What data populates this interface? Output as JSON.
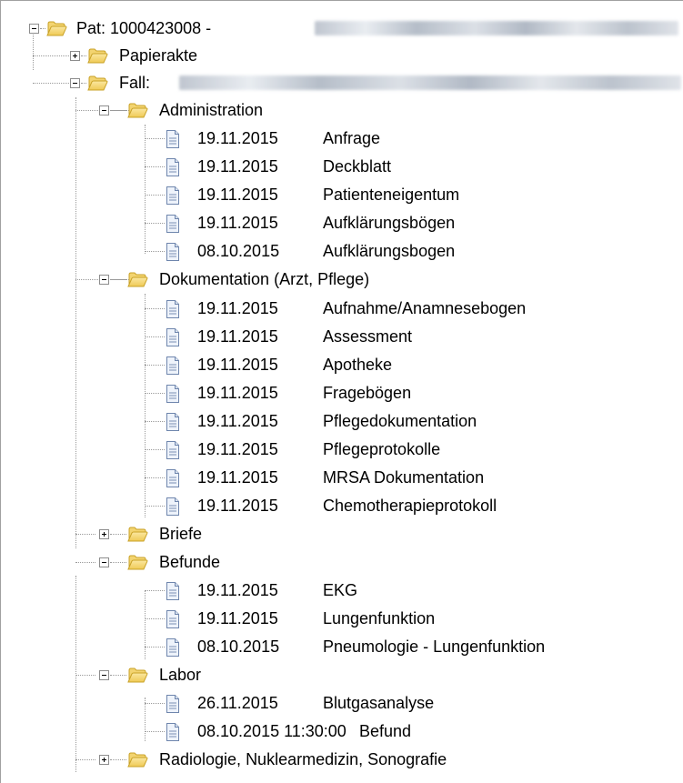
{
  "root": {
    "label": "Pat: 1000423008 -",
    "expanded": true
  },
  "papierakte": {
    "label": "Papierakte",
    "expanded": false
  },
  "fall": {
    "label": "Fall:",
    "expanded": true
  },
  "administration": {
    "label": "Administration",
    "expanded": true,
    "items": [
      {
        "date": "19.11.2015",
        "title": "Anfrage"
      },
      {
        "date": "19.11.2015",
        "title": "Deckblatt"
      },
      {
        "date": "19.11.2015",
        "title": "Patienteneigentum"
      },
      {
        "date": "19.11.2015",
        "title": "Aufklärungsbögen"
      },
      {
        "date": "08.10.2015",
        "title": "Aufklärungsbogen"
      }
    ]
  },
  "dokumentation": {
    "label": "Dokumentation (Arzt, Pflege)",
    "expanded": true,
    "items": [
      {
        "date": "19.11.2015",
        "title": "Aufnahme/Anamnesebogen"
      },
      {
        "date": "19.11.2015",
        "title": "Assessment"
      },
      {
        "date": "19.11.2015",
        "title": "Apotheke"
      },
      {
        "date": "19.11.2015",
        "title": "Fragebögen"
      },
      {
        "date": "19.11.2015",
        "title": "Pflegedokumentation"
      },
      {
        "date": "19.11.2015",
        "title": "Pflegeprotokolle"
      },
      {
        "date": "19.11.2015",
        "title": "MRSA Dokumentation"
      },
      {
        "date": "19.11.2015",
        "title": "Chemotherapieprotokoll"
      }
    ]
  },
  "briefe": {
    "label": "Briefe",
    "expanded": false
  },
  "befunde": {
    "label": "Befunde",
    "expanded": true,
    "items": [
      {
        "date": "19.11.2015",
        "title": "EKG"
      },
      {
        "date": "19.11.2015",
        "title": "Lungenfunktion"
      },
      {
        "date": "08.10.2015",
        "title": "Pneumologie - Lungenfunktion"
      }
    ]
  },
  "labor": {
    "label": "Labor",
    "expanded": true,
    "items": [
      {
        "date": "26.11.2015",
        "title": "Blutgasanalyse"
      },
      {
        "date": "08.10.2015 11:30:00",
        "title": "Befund"
      }
    ]
  },
  "radiologie": {
    "label": "Radiologie, Nuklearmedizin, Sonografie",
    "expanded": false
  },
  "colors": {
    "folder_fill": "#f5d76e",
    "folder_edge": "#c9a227",
    "doc_fill": "#eef3fb",
    "doc_edge": "#6f86ad",
    "line": "#9a9a9a"
  }
}
